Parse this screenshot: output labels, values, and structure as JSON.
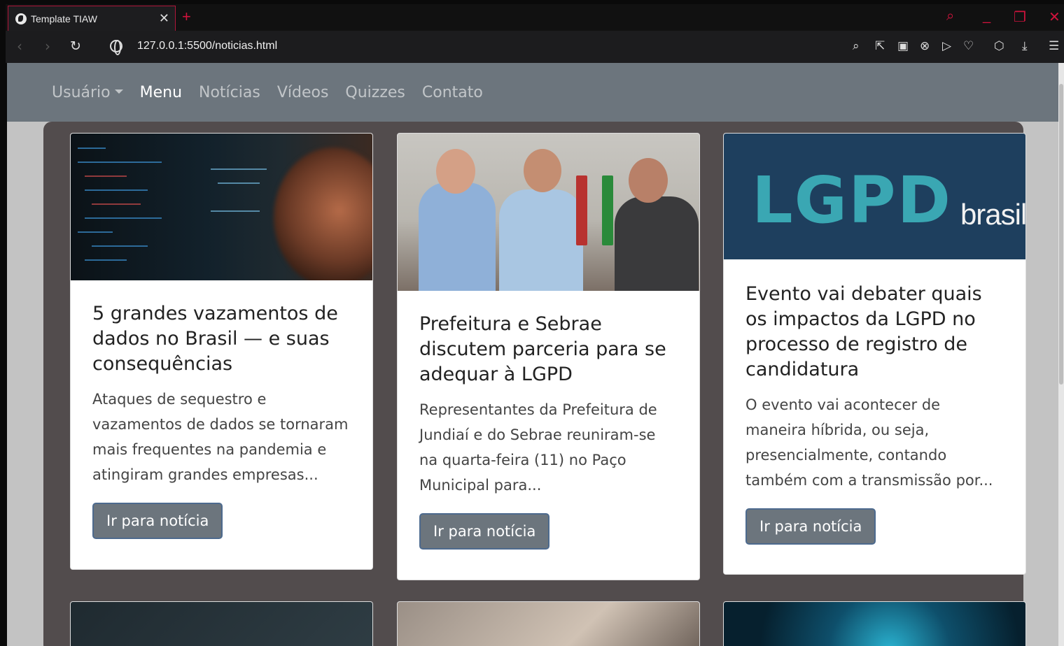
{
  "browser": {
    "tab_title": "Template TIAW",
    "new_tab": "+",
    "url": "127.0.0.1:5500/noticias.html"
  },
  "nav": {
    "user": "Usuário",
    "menu": "Menu",
    "news": "Notícias",
    "videos": "Vídeos",
    "quizzes": "Quizzes",
    "contact": "Contato"
  },
  "cards": [
    {
      "title": "5 grandes vazamentos de dados no Brasil — e suas consequências",
      "text": "Ataques de sequestro e vazamentos de dados se tornaram mais frequentes na pandemia e atingiram grandes empresas...",
      "button": "Ir para notícia"
    },
    {
      "title": "Prefeitura e Sebrae discutem parceria para se adequar à LGPD",
      "text": "Representantes da Prefeitura de Jundiaí e do Sebrae reuniram-se na quarta-feira (11) no Paço Municipal para...",
      "button": "Ir para notícia"
    },
    {
      "title": "Evento vai debater quais os impactos da LGPD no processo de registro de candidatura",
      "text": "O evento vai acontecer de maneira híbrida, ou seja, presencialmente, contando também com a transmissão por...",
      "button": "Ir para notícia",
      "logo_main": "LGPD",
      "logo_domain": "brasil.com.br"
    }
  ],
  "colors": {
    "navbar": "#6c757d",
    "panel": "#524c4d",
    "browser_accent": "#d0133c"
  }
}
